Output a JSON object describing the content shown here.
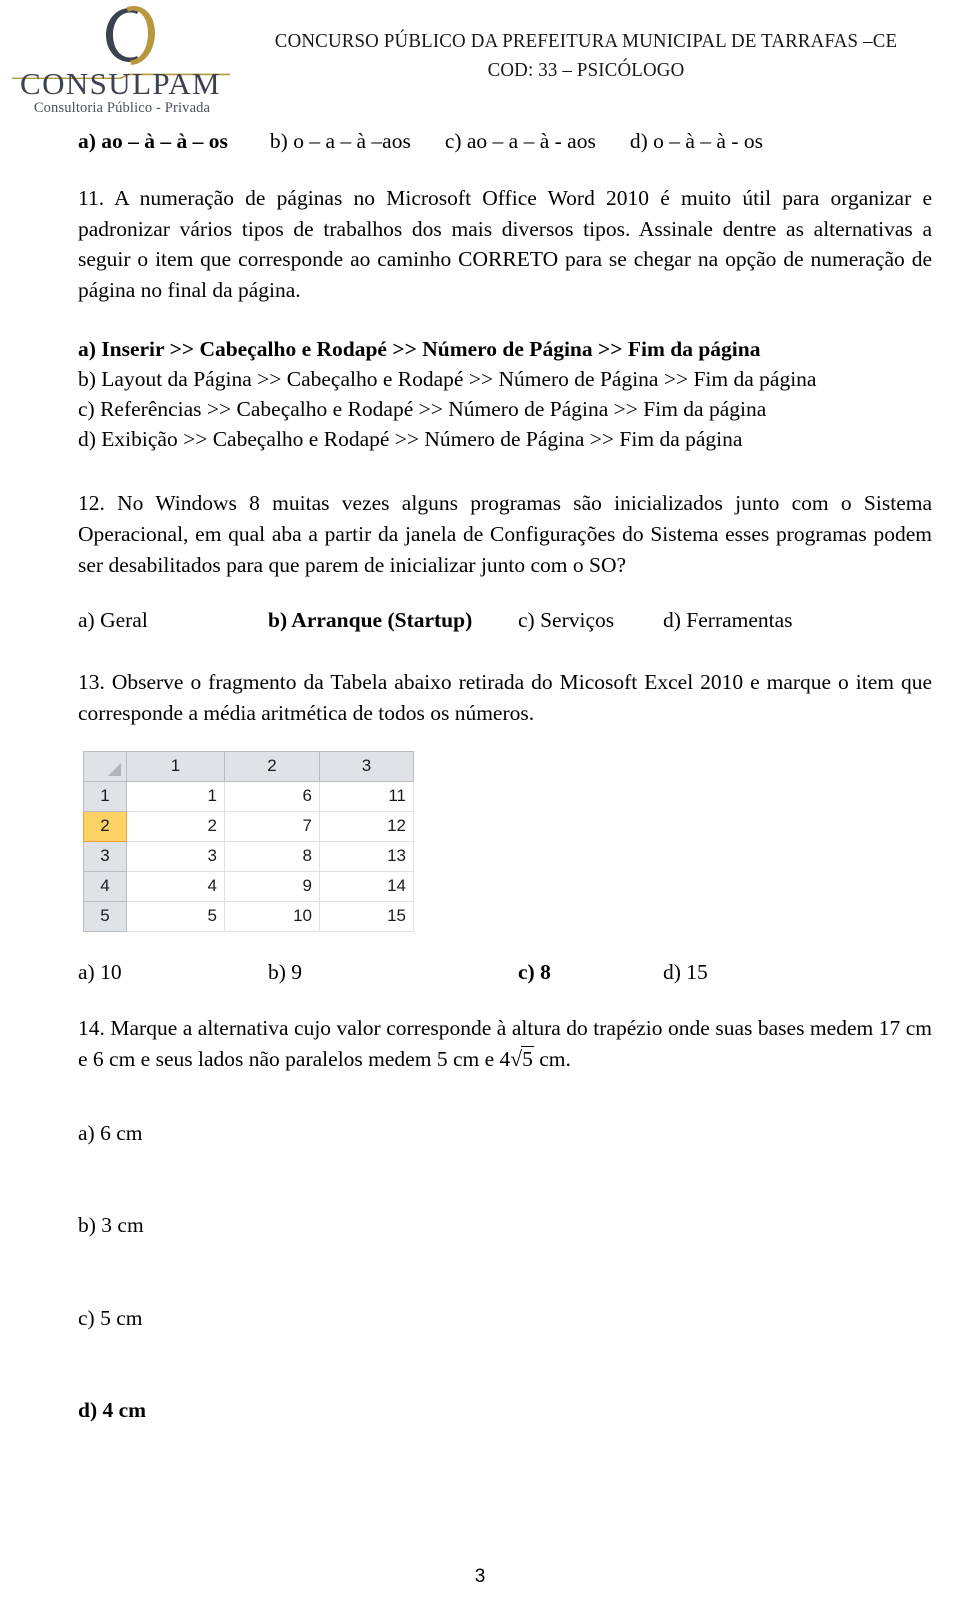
{
  "header": {
    "logo": {
      "wordmark": "CONSULPAM",
      "tagline": "Consultoria Público - Privada",
      "mark_icon": "consulpam-c-monogram-icon",
      "dark_color": "#3d4250",
      "gold_color": "#b8973f"
    },
    "title_line1": "CONCURSO PÚBLICO DA PREFEITURA MUNICIPAL DE TARRAFAS –CE",
    "title_line2": "COD: 33 – PSICÓLOGO"
  },
  "prev_question_options": {
    "a": "a) ao – à – à – os",
    "b": "b) o – a – à –aos",
    "c": "c) ao – a – à - aos",
    "d": "d) o – à – à - os"
  },
  "questions": [
    {
      "number": "11",
      "text": "11. A numeração de páginas no Microsoft Office Word 2010 é muito útil para organizar e padronizar vários tipos de trabalhos dos mais diversos tipos. Assinale dentre as alternativas a seguir o item que corresponde ao caminho CORRETO para se chegar na opção de numeração de página no final da página.",
      "options": [
        "a) Inserir >> Cabeçalho e Rodapé >> Número de Página >> Fim da página",
        "b) Layout da Página >> Cabeçalho e Rodapé >> Número de Página >> Fim da página",
        "c) Referências >> Cabeçalho e Rodapé >> Número de Página >> Fim da página",
        "d) Exibição >> Cabeçalho e Rodapé >> Número de Página >> Fim da página"
      ],
      "bold_option_index": 0
    },
    {
      "number": "12",
      "text": "12. No Windows 8 muitas vezes alguns programas são inicializados junto com o Sistema Operacional, em qual aba a partir da janela de Configurações do Sistema esses programas podem ser desabilitados para que parem de inicializar junto com o SO?",
      "options": [
        "a) Geral",
        "b) Arranque (Startup)",
        "c) Serviços",
        "d) Ferramentas"
      ],
      "bold_option_index": 1
    },
    {
      "number": "13",
      "text": "13. Observe o fragmento da Tabela abaixo retirada do Micosoft Excel 2010 e marque o item que corresponde a média aritmética de todos os números.",
      "options": [
        "a) 10",
        "b) 9",
        "c) 8",
        "d) 15"
      ],
      "bold_option_index": 2
    },
    {
      "number": "14",
      "text_part1": "14. Marque a alternativa cujo valor corresponde à altura do trapézio onde suas bases medem 17 cm e 6 cm e seus lados não paralelos medem 5 cm e 4",
      "radicand": "5",
      "text_part2": " cm.",
      "options": [
        "a) 6 cm",
        "b) 3 cm",
        "c) 5 cm",
        "d) 4 cm"
      ],
      "bold_option_index": 3
    }
  ],
  "excel_table": {
    "corner_icon": "select-all-triangle-icon",
    "column_headers": [
      "1",
      "2",
      "3"
    ],
    "row_headers": [
      "1",
      "2",
      "3",
      "4",
      "5"
    ],
    "selected_row_header": "2",
    "rows": [
      [
        "1",
        "6",
        "11"
      ],
      [
        "2",
        "7",
        "12"
      ],
      [
        "3",
        "8",
        "13"
      ],
      [
        "4",
        "9",
        "14"
      ],
      [
        "5",
        "10",
        "15"
      ]
    ],
    "header_bg": "#dfe2e6",
    "selected_bg": "#fcd265"
  },
  "footer": {
    "page_number": "3"
  }
}
